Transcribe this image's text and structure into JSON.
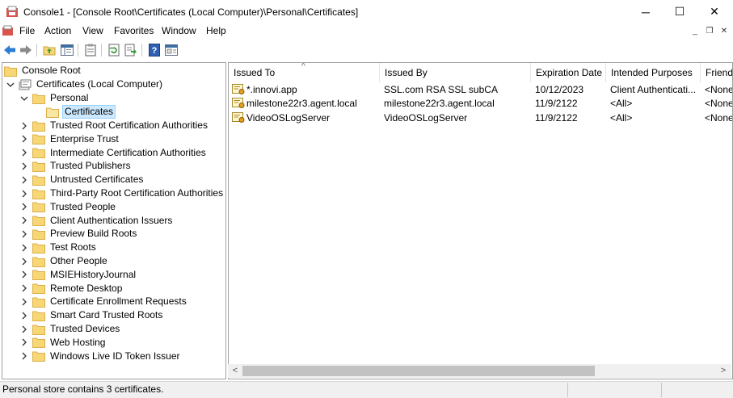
{
  "window": {
    "title": "Console1 - [Console Root\\Certificates (Local Computer)\\Personal\\Certificates]",
    "buttons": {
      "minimize": "─",
      "maximize": "☐",
      "close": "✕"
    }
  },
  "menu": {
    "items": [
      "File",
      "Action",
      "View",
      "Favorites",
      "Window",
      "Help"
    ],
    "mdi": {
      "minimize": "_",
      "restore": "❐",
      "close": "✕"
    }
  },
  "toolbar": {
    "icons": [
      "back-arrow-icon",
      "forward-arrow-icon",
      "up-folder-icon",
      "show-hide-tree-icon",
      "clipboard-icon",
      "refresh-icon",
      "export-list-icon",
      "help-icon",
      "mmc-icon"
    ]
  },
  "tree": {
    "root": "Console Root",
    "certs": "Certificates (Local Computer)",
    "personal": "Personal",
    "certificates": "Certificates",
    "stores": [
      "Trusted Root Certification Authorities",
      "Enterprise Trust",
      "Intermediate Certification Authorities",
      "Trusted Publishers",
      "Untrusted Certificates",
      "Third-Party Root Certification Authorities",
      "Trusted People",
      "Client Authentication Issuers",
      "Preview Build Roots",
      "Test Roots",
      "Other People",
      "MSIEHistoryJournal",
      "Remote Desktop",
      "Certificate Enrollment Requests",
      "Smart Card Trusted Roots",
      "Trusted Devices",
      "Web Hosting",
      "Windows Live ID Token Issuer"
    ]
  },
  "list": {
    "columns": [
      "Issued To",
      "Issued By",
      "Expiration Date",
      "Intended Purposes",
      "Friendl"
    ],
    "sort_indicator": "^",
    "rows": [
      [
        "*.innovi.app",
        "SSL.com RSA SSL subCA",
        "10/12/2023",
        "Client Authenticati...",
        "<None"
      ],
      [
        "milestone22r3.agent.local",
        "milestone22r3.agent.local",
        "11/9/2122",
        "<All>",
        "<None"
      ],
      [
        "VideoOSLogServer",
        "VideoOSLogServer",
        "11/9/2122",
        "<All>",
        "<None"
      ]
    ]
  },
  "scroll": {
    "left": "<",
    "right": ">"
  },
  "status": {
    "text": "Personal store contains 3 certificates."
  },
  "colors": {
    "selection": "#cce8ff",
    "folder": "#f7d675",
    "folder_edge": "#dcb04a",
    "back_arrow": "#2b7cd3"
  }
}
